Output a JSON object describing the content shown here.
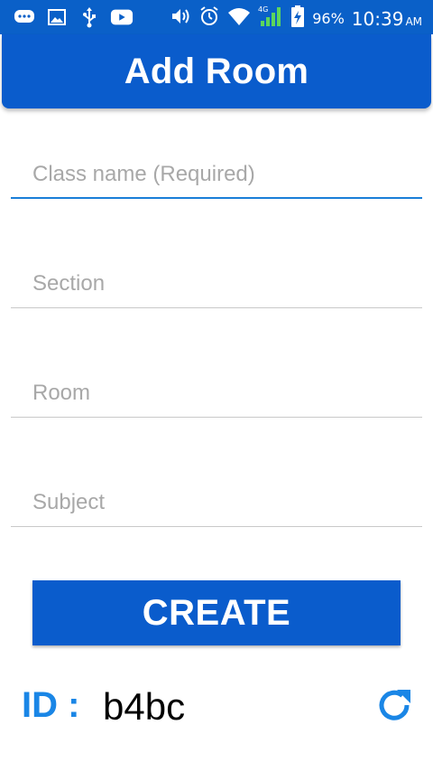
{
  "status_bar": {
    "left_icons": [
      "messaging-icon",
      "gallery-icon",
      "usb-icon",
      "youtube-icon"
    ],
    "right_icons": [
      "volume-icon",
      "alarm-icon",
      "wifi-icon",
      "signal-icon",
      "battery-charging-icon"
    ],
    "battery": "96%",
    "time": "10:39",
    "ampm": "AM"
  },
  "app_bar": {
    "title": "Add Room"
  },
  "form": {
    "class_name_placeholder": "Class name (Required)",
    "section_placeholder": "Section",
    "room_placeholder": "Room",
    "subject_placeholder": "Subject"
  },
  "create_button": {
    "label": "CREATE"
  },
  "room_id": {
    "label": "ID :",
    "value": "b4bc",
    "refresh_icon": "refresh-icon"
  },
  "colors": {
    "primary": "#0a5ccc",
    "accent": "#1a86e6",
    "active_underline": "#1a7ed8",
    "divider": "#c9c9c9",
    "placeholder": "#a8a8a8"
  }
}
